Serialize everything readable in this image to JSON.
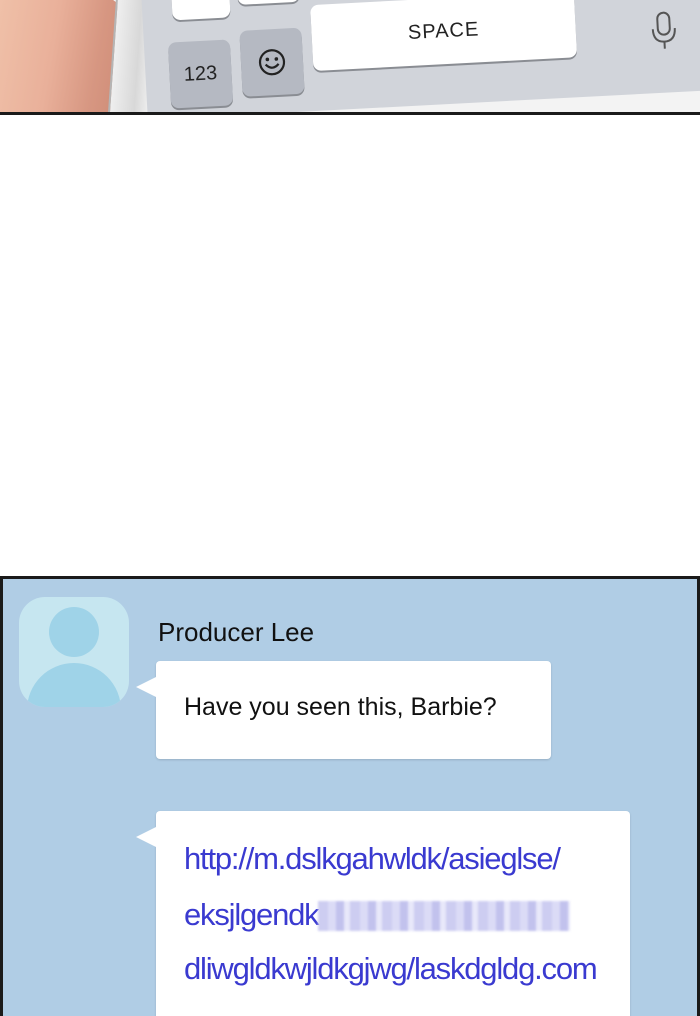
{
  "keyboard": {
    "key_123_label": "123",
    "emoji_key_icon": "smiley-face-icon",
    "space_key_label": "SPACE",
    "mic_key_icon": "microphone-icon"
  },
  "chat": {
    "sender_name": "Producer Lee",
    "avatar_icon": "default-person-avatar-icon",
    "messages": [
      {
        "text": "Have you seen this, Barbie?"
      },
      {
        "link_lines": [
          "http://m.dslkgahwldk/asieglse/",
          "eksjlgendk",
          "dliwgldkwjldkgjwg/laskdgldg.com"
        ]
      }
    ],
    "colors": {
      "background": "#b0cde5",
      "bubble": "#ffffff",
      "link": "#3a3ad0",
      "avatar": "#9fd3e8"
    }
  }
}
